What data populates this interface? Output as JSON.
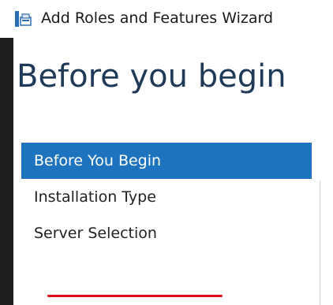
{
  "window": {
    "title": "Add Roles and Features Wizard",
    "icon": "server-manager-icon"
  },
  "page": {
    "heading": "Before you begin"
  },
  "steps": [
    {
      "label": "Before You Begin",
      "active": true
    },
    {
      "label": "Installation Type",
      "active": false
    },
    {
      "label": "Server Selection",
      "active": false
    }
  ],
  "colors": {
    "accent": "#1e73be",
    "heading": "#1f3a58",
    "annotation": "#e0101a"
  }
}
